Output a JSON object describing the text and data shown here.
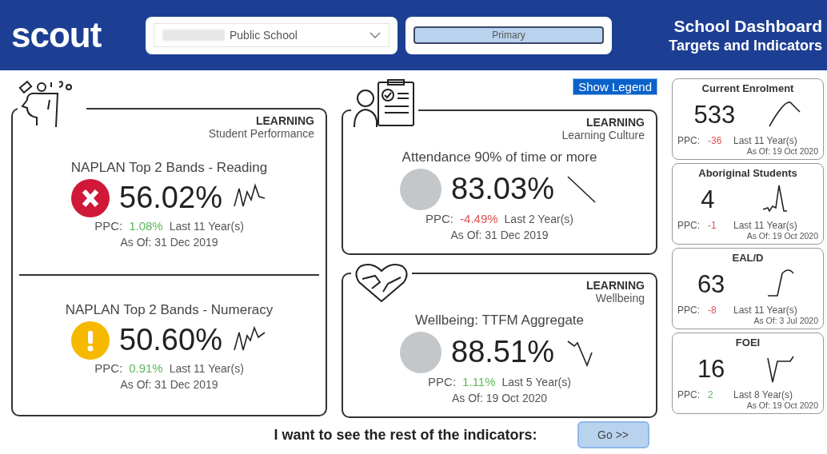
{
  "header": {
    "logo": "scout",
    "school_select": {
      "value": "Public School"
    },
    "level_select": {
      "value": "Primary"
    },
    "title": "School Dashboard",
    "subtitle": "Targets and Indicators"
  },
  "legend_button": "Show Legend",
  "domain_cards": [
    {
      "kind": "head",
      "domain": "LEARNING",
      "subdomain": "Student Performance",
      "measures": [
        {
          "title": "NAPLAN Top 2 Bands - Reading",
          "kind": "fail",
          "value": "56.02%",
          "ppc_label": "PPC:",
          "ppc": "1.08%",
          "positive": true,
          "period": "Last 11 Year(s)",
          "as_of": "As Of: 31 Dec 2019"
        },
        {
          "title": "NAPLAN Top 2 Bands - Numeracy",
          "kind": "warning",
          "value": "50.60%",
          "ppc_label": "PPC:",
          "ppc": "0.91%",
          "positive": true,
          "period": "Last 11 Year(s)",
          "as_of": "As Of: 31 Dec 2019"
        }
      ]
    },
    {
      "kind": "teacher",
      "domain": "LEARNING",
      "subdomain": "Learning Culture",
      "measures": [
        {
          "title": "Attendance 90% of time or more",
          "kind": "none",
          "value": "83.03%",
          "ppc_label": "PPC:",
          "ppc": "-4.49%",
          "positive": false,
          "period": "Last 2 Year(s)",
          "as_of": "As Of: 31 Dec 2019"
        }
      ]
    },
    {
      "kind": "heart",
      "domain": "LEARNING",
      "subdomain": "Wellbeing",
      "measures": [
        {
          "title": "Wellbeing: TTFM Aggregate",
          "kind": "none",
          "value": "88.51%",
          "ppc_label": "PPC:",
          "ppc": "1.11%",
          "positive": true,
          "period": "Last 5 Year(s)",
          "as_of": "As Of: 19 Oct 2020"
        }
      ]
    }
  ],
  "side_cards": [
    {
      "title": "Current Enrolment",
      "value": "533",
      "ppc_label": "PPC:",
      "ppc": "-36",
      "positive": false,
      "period": "Last 11 Year(s)",
      "as_of": "As Of: 19 Oct 2020"
    },
    {
      "title": "Aboriginal Students",
      "value": "4",
      "ppc_label": "PPC:",
      "ppc": "-1",
      "positive": false,
      "period": "Last 11 Year(s)",
      "as_of": "As Of: 19 Oct 2020"
    },
    {
      "title": "EAL/D",
      "value": "63",
      "ppc_label": "PPC:",
      "ppc": "-8",
      "positive": false,
      "period": "Last 11 Year(s)",
      "as_of": "As Of: 3 Jul 2020"
    },
    {
      "title": "FOEI",
      "value": "16",
      "ppc_label": "PPC:",
      "ppc": "2",
      "positive": true,
      "period": "Last 8 Year(s)",
      "as_of": "As Of: 19 Oct 2020"
    }
  ],
  "footer": {
    "prompt": "I want to see the rest of the indicators:",
    "button": "Go >>"
  }
}
